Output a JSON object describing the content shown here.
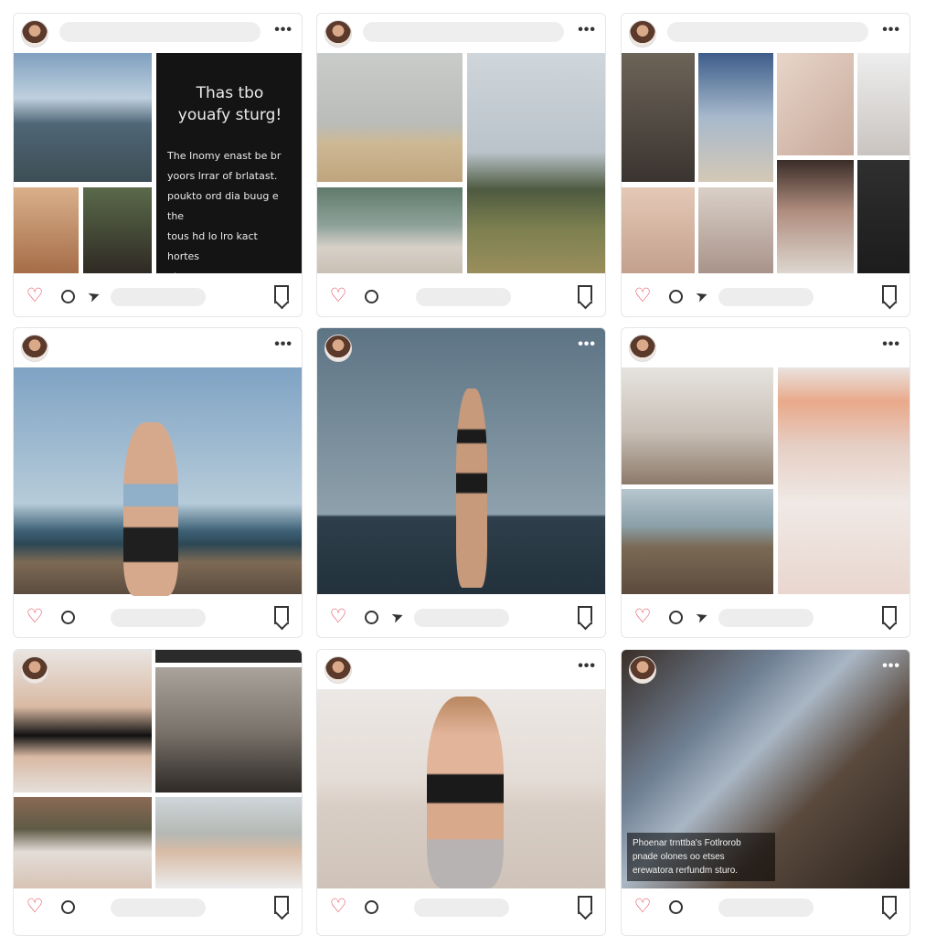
{
  "colors": {
    "like_red": "#e03c50",
    "icon_dark": "#333333",
    "placeholder_grey": "#ededed"
  },
  "icons": [
    "heart-icon",
    "comment-icon",
    "send-icon",
    "bookmark-icon",
    "more-icon"
  ],
  "posts": [
    {
      "text_tile": {
        "title": "Thas tbo\nyouafy sturg!",
        "body": "The Inomy enast be br\nyoors lrrar of brlatast.\npoukto ord dia buug e the\ntous hd lo lro kact hortes\nutee."
      }
    },
    {},
    {},
    {},
    {},
    {},
    {},
    {},
    {
      "overlay_caption": "Phoenar trnttba's Fotlrorob\npnade olones oo etses\nerewatora rerfundm sturo."
    }
  ],
  "more_label": "•••",
  "heart_glyph": "♡",
  "send_glyph": "➤"
}
